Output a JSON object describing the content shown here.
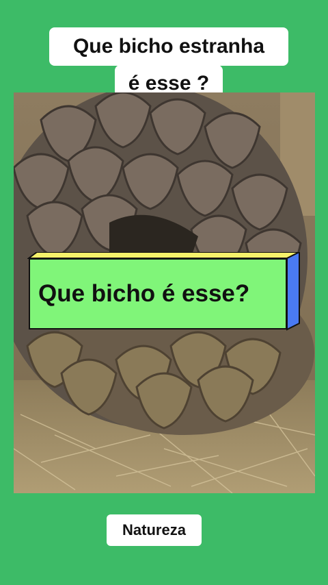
{
  "top_caption": {
    "line1": "Que bicho estranha",
    "line2": "é esse ?"
  },
  "center_banner": {
    "text": "Que bicho é esse?",
    "face_color": "#80f579",
    "top_color": "#f6f26b",
    "side_color": "#4a7af2"
  },
  "footer": {
    "label": "Natureza"
  },
  "colors": {
    "background": "#3dbb67",
    "caption_bg": "#ffffff"
  }
}
